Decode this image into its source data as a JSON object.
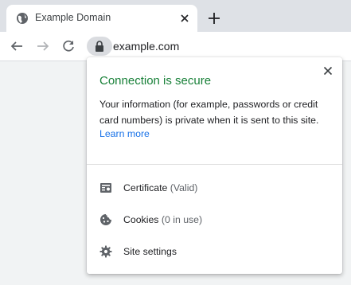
{
  "tab": {
    "title": "Example Domain",
    "favicon_icon": "globe-icon",
    "close_icon": "close-icon"
  },
  "new_tab_icon": "plus-icon",
  "toolbar": {
    "back_icon": "back-arrow-icon",
    "forward_icon": "forward-arrow-icon",
    "reload_icon": "reload-icon",
    "lock_icon": "lock-icon",
    "url": "example.com"
  },
  "popup": {
    "title": "Connection is secure",
    "title_color": "#188038",
    "description": "Your information (for example, passwords or credit card numbers) is private when it is sent to this site.",
    "learn_more": "Learn more",
    "link_color": "#1a73e8",
    "close_icon": "close-icon",
    "rows": [
      {
        "label": "Certificate",
        "status": "(Valid)",
        "icon": "certificate-icon"
      },
      {
        "label": "Cookies",
        "status": "(0 in use)",
        "icon": "cookie-icon"
      },
      {
        "label": "Site settings",
        "status": "",
        "icon": "gear-icon"
      }
    ]
  }
}
